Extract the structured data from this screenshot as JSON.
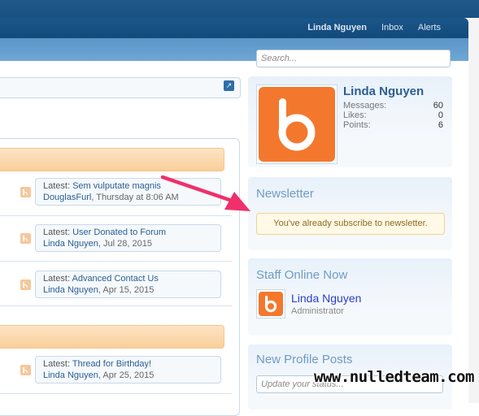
{
  "header": {
    "nav": {
      "user": "Linda Nguyen",
      "inbox": "Inbox",
      "alerts": "Alerts"
    }
  },
  "search": {
    "placeholder": "Search..."
  },
  "forum": {
    "rows": [
      {
        "prefix": "Latest:",
        "title": "Sem vulputate magnis",
        "user": "DouglasFurl",
        "time": ", Thursday at 8:06 AM"
      },
      {
        "prefix": "Latest:",
        "title": "User Donated to Forum",
        "user": "Linda Nguyen",
        "time": ", Jul 28, 2015"
      },
      {
        "prefix": "Latest:",
        "title": "Advanced Contact Us",
        "user": "Linda Nguyen",
        "time": ", Apr 15, 2015"
      },
      {
        "prefix": "Latest:",
        "title": "Thread for Birthday!",
        "user": "Linda Nguyen",
        "time": ", Apr 25, 2015"
      }
    ]
  },
  "visitor": {
    "name": "Linda Nguyen",
    "stats": [
      {
        "label": "Messages:",
        "value": "60"
      },
      {
        "label": "Likes:",
        "value": "0"
      },
      {
        "label": "Points:",
        "value": "6"
      }
    ]
  },
  "newsletter": {
    "title": "Newsletter",
    "message": "You've already subscribe to newsletter."
  },
  "staff": {
    "title": "Staff Online Now",
    "name": "Linda Nguyen",
    "role": "Administrator"
  },
  "profile_posts": {
    "title": "New Profile Posts",
    "placeholder": "Update your status..."
  },
  "watermark": "www.nulledteam.com",
  "colors": {
    "accent": "#f3782d",
    "link": "#2b5e91",
    "arrow": "#f0306a"
  }
}
